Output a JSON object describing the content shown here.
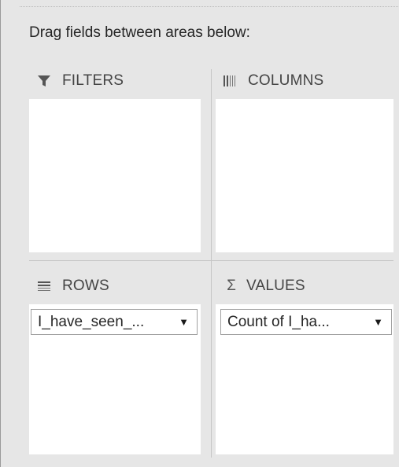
{
  "instruction": "Drag fields between areas below:",
  "areas": {
    "filters": {
      "label": "FILTERS",
      "icon": "filter-icon"
    },
    "columns": {
      "label": "COLUMNS",
      "icon": "columns-icon"
    },
    "rows": {
      "label": "ROWS",
      "icon": "rows-icon",
      "fields": [
        {
          "label": "I_have_seen_...",
          "dropdown": "▼"
        }
      ]
    },
    "values": {
      "label": "VALUES",
      "icon": "sigma-icon",
      "icon_glyph": "Σ",
      "fields": [
        {
          "label": "Count of I_ha...",
          "dropdown": "▼"
        }
      ]
    }
  },
  "colors": {
    "pane_background": "#e6e6e6",
    "area_background": "#ffffff",
    "divider": "#c6c6c6",
    "text": "#262626"
  }
}
